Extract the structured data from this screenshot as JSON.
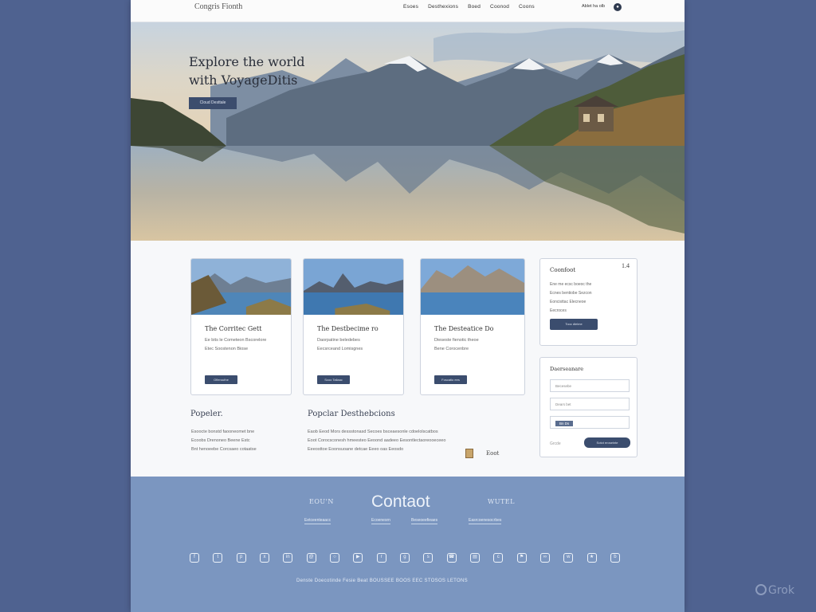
{
  "nav": {
    "logo": "Congris Fionth",
    "links": [
      "Esoes",
      "Desthexions",
      "Boed",
      "Coonod",
      "Coons"
    ],
    "right_text": "Ablet ha olb",
    "icon": "search-icon"
  },
  "hero": {
    "title_line1": "Explore the world",
    "title_line2": "with VoyageDitis",
    "button_label": "Cloud Desttale"
  },
  "cards": [
    {
      "title": "The Corritec Gett",
      "lines": [
        "Ee bits le Cometeon Bscorelore",
        "Etec Soostenon Biose"
      ],
      "button_label": "Oflerouthe"
    },
    {
      "title": "The Destbecime ro",
      "lines": [
        "Daorpatine beledebes",
        "Eecsrceand Lomisgnes"
      ],
      "button_label": "Scoo Tallaac"
    },
    {
      "title": "The Desteatice Do",
      "lines": [
        "Dieseste fienotic theoe",
        "Bene Corocenbre"
      ],
      "button_label": "Foscatio ees"
    }
  ],
  "contact_panel": {
    "title": "Coonfoot",
    "number": "1.4",
    "lines": [
      "Ene me ecsc boeoc the",
      "Ecnes bentiobe Sezcon",
      "Eoncisttac Elecneoe",
      "Eecroces"
    ],
    "button_label": "Tooc dlelme"
  },
  "form_panel": {
    "title": "Daerseanare",
    "fields": [
      "Becesebe",
      "Dears bet",
      "Bn Ds"
    ],
    "footer_text": "Grcde",
    "button_label": "Sotot eroseinte"
  },
  "popular_left": {
    "heading": "Popeler.",
    "lines": [
      "Esoocte bonstd faooneomet bne",
      "Ecoobs Drenoneo Beene Estc",
      "Bnt henoeebe Corcsaeo cotaatse"
    ]
  },
  "popular_main": {
    "heading": "Popclar Desthebcions",
    "lines": [
      "Eaob Eeod Mors dessstonasd Secoes bsceaesonle cdoelolscatbos",
      "Eoot Corocsconesh hmeesteo Eeoond aadeeo Eesontlectaoreooeceeo",
      "Eeeosttoe Eoonsuoane detcae Eeeo oas Eeosdo"
    ],
    "mini_label": "Eoot"
  },
  "footer": {
    "left_heading": "EOU'N",
    "main_heading": "Contaot",
    "right_heading": "WUTEL",
    "links": [
      "Eetceenteaacc",
      "Ecoenesrn",
      "Beseoeefieaes",
      "Easrcoenesocrbes"
    ],
    "social_icons": [
      "facebook-icon",
      "twitter-icon",
      "pinterest-icon",
      "x-icon",
      "linkedin-icon",
      "mail-icon",
      "instagram-icon",
      "youtube-icon",
      "rss-icon",
      "globe-icon",
      "share-icon",
      "phone-icon",
      "print-icon",
      "chat-icon",
      "flag-icon",
      "link-icon",
      "whatsapp-icon",
      "star-icon",
      "bookmark-icon"
    ],
    "copyright": "Denste Doecotinde Fesie Beat BOUSSEE BOOS EEC STOSOS LETONS"
  },
  "watermark": "Grok"
}
